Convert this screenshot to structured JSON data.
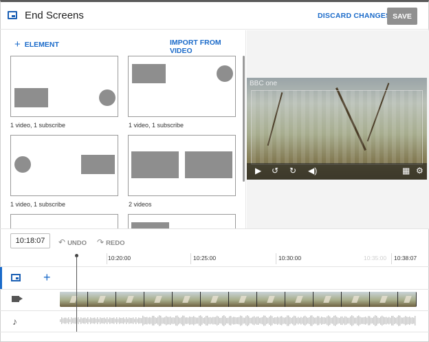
{
  "header": {
    "title": "End Screens",
    "discard_label": "DISCARD CHANGES",
    "save_label": "SAVE"
  },
  "left_panel": {
    "add_element_label": "ELEMENT",
    "import_label": "IMPORT FROM VIDEO",
    "templates": [
      {
        "caption": "1 video, 1 subscribe"
      },
      {
        "caption": "1 video, 1 subscribe"
      },
      {
        "caption": "1 video, 1 subscribe"
      },
      {
        "caption": "2 videos"
      }
    ]
  },
  "preview": {
    "watermark": "BBC one"
  },
  "timeline": {
    "current_time": "10:18:07",
    "undo_label": "UNDO",
    "redo_label": "REDO",
    "ticks": [
      "10:20:00",
      "10:25:00",
      "10:30:00",
      "10:35:00",
      "10:38:07"
    ]
  },
  "colors": {
    "accent": "#1a6ac9",
    "save_disabled": "#909090"
  },
  "icons": {
    "header": "end-screen-icon",
    "add": "plus-icon",
    "undo": "undo-icon",
    "redo": "redo-icon",
    "video_track": "camera-icon",
    "audio_track": "music-note-icon",
    "player": [
      "play-icon",
      "rewind-icon",
      "forward-icon",
      "volume-icon",
      "grid-icon",
      "settings-icon"
    ]
  }
}
